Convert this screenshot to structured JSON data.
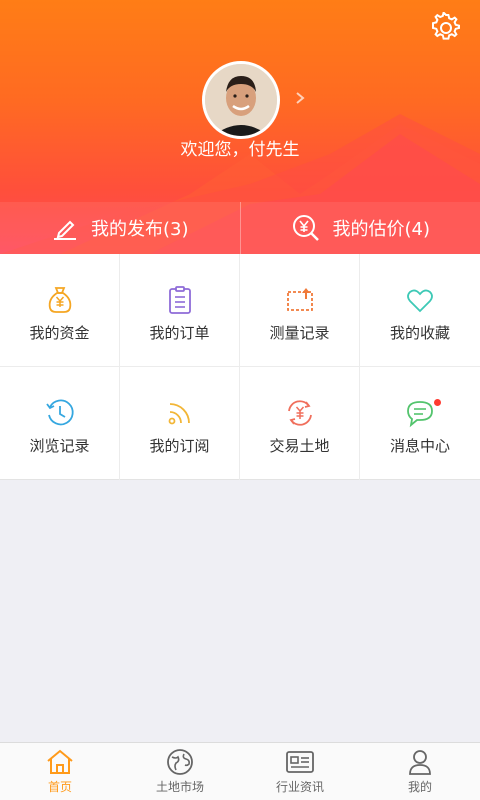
{
  "profile": {
    "welcome": "欢迎您，付先生"
  },
  "stats": [
    {
      "label": "我的发布(3)",
      "icon": "edit-icon"
    },
    {
      "label": "我的估价(4)",
      "icon": "valuation-icon"
    }
  ],
  "menu": [
    {
      "label": "我的资金",
      "icon": "money-bag-icon",
      "color": "#f5a623"
    },
    {
      "label": "我的订单",
      "icon": "clipboard-icon",
      "color": "#8e6bd8"
    },
    {
      "label": "测量记录",
      "icon": "measure-icon",
      "color": "#f07a3a"
    },
    {
      "label": "我的收藏",
      "icon": "heart-icon",
      "color": "#3ec9b6"
    },
    {
      "label": "浏览记录",
      "icon": "history-icon",
      "color": "#35a7e0"
    },
    {
      "label": "我的订阅",
      "icon": "rss-icon",
      "color": "#f2b637"
    },
    {
      "label": "交易土地",
      "icon": "exchange-icon",
      "color": "#f06f5c"
    },
    {
      "label": "消息中心",
      "icon": "message-icon",
      "color": "#53c46d"
    }
  ],
  "tabs": [
    {
      "label": "首页",
      "icon": "home-icon",
      "active": true
    },
    {
      "label": "土地市场",
      "icon": "globe-icon",
      "active": false
    },
    {
      "label": "行业资讯",
      "icon": "news-icon",
      "active": false
    },
    {
      "label": "我的",
      "icon": "user-icon",
      "active": false
    }
  ],
  "colors": {
    "accent": "#ff9a1a",
    "header_top": "#ff7d16",
    "header_bottom": "#ff4a5a",
    "badge": "#ff3b30"
  }
}
